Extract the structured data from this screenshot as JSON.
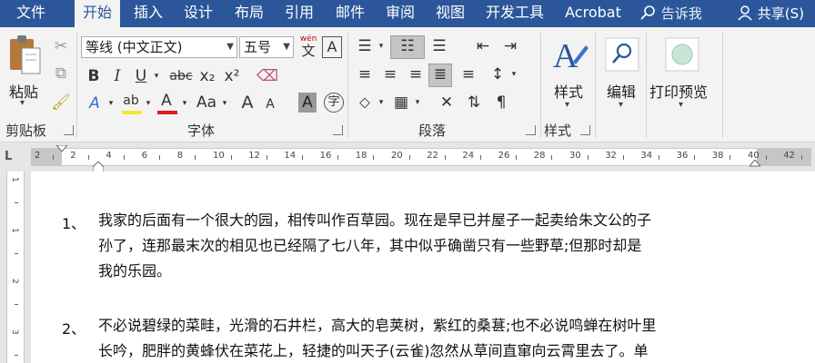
{
  "tabs": [
    "文件",
    "开始",
    "插入",
    "设计",
    "布局",
    "引用",
    "邮件",
    "审阅",
    "视图",
    "开发工具",
    "Acrobat"
  ],
  "active_tab": "开始",
  "tell_me": "告诉我",
  "share": "共享(S)",
  "clipboard": {
    "paste": "粘贴",
    "label": "剪贴板"
  },
  "font": {
    "name": "等线 (中文正文)",
    "size": "五号",
    "wen_top": "wén",
    "wen_char": "文",
    "a_box": "A",
    "bold": "B",
    "italic": "I",
    "underline": "U",
    "strike": "abc",
    "sub": "x₂",
    "sup": "x²",
    "aa": "Aa",
    "grow": "A",
    "shrink": "A",
    "label": "字体"
  },
  "paragraph": {
    "label": "段落"
  },
  "styles": {
    "label": "样式",
    "button": "样式"
  },
  "editing": {
    "label": "编辑"
  },
  "print_preview": {
    "label": "打印预览"
  },
  "colors": {
    "highlight": "#f5e62c",
    "font_color": "#e01b1b",
    "accent": "#2b579a"
  },
  "ruler": {
    "corner": "L",
    "numbers": [
      "2",
      "2",
      "4",
      "6",
      "8",
      "10",
      "12",
      "14",
      "16",
      "18",
      "20",
      "22",
      "24",
      "26",
      "28",
      "30",
      "32",
      "34",
      "36",
      "38",
      "40",
      "42"
    ]
  },
  "vruler": {
    "numbers": [
      "1",
      "1",
      "2",
      "3"
    ]
  },
  "document": {
    "paragraphs": [
      {
        "num": "1、",
        "lines": [
          "我家的后面有一个很大的园，相传叫作百草园。现在是早已并屋子一起卖给朱文公的子",
          "孙了，连那最末次的相见也已经隔了七八年，其中似乎确凿只有一些野草;但那时却是",
          "我的乐园。"
        ]
      },
      {
        "num": "2、",
        "lines": [
          "不必说碧绿的菜畦，光滑的石井栏，高大的皂荚树，紫红的桑葚;也不必说鸣蝉在树叶里",
          "长吟，肥胖的黄蜂伏在菜花上，轻捷的叫天子(云雀)忽然从草间直窜向云霄里去了。单"
        ]
      }
    ]
  }
}
